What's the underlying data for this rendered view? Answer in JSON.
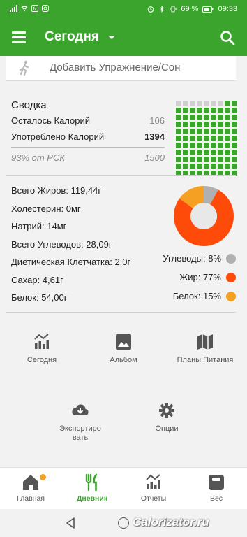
{
  "status_bar": {
    "battery": "69 %",
    "time": "09:33"
  },
  "header": {
    "title": "Сегодня"
  },
  "exercise": {
    "label": "Добавить Упражнение/Сон"
  },
  "summary": {
    "title": "Сводка",
    "remaining_label": "Осталось Калорий",
    "remaining_value": "106",
    "consumed_label": "Употреблено Калорий",
    "consumed_value": "1394",
    "rdi_label": "93% от РСК",
    "rdi_value": "1500",
    "grid_fraction": 0.93
  },
  "nutrients": [
    "Всего Жиров: 119,44г",
    "Холестерин: 0мг",
    "Натрий: 14мг",
    "Всего Углеводов: 28,09г",
    "Диетическая Клетчатка: 2,0г",
    "Сахар: 4,61г",
    "Белок: 54,00г"
  ],
  "macro_legend": [
    {
      "label": "Углеводы: 8%",
      "color": "#b0b0b0",
      "value": 8
    },
    {
      "label": "Жир: 77%",
      "color": "#ff4b0a",
      "value": 77
    },
    {
      "label": "Белок: 15%",
      "color": "#f5a023",
      "value": 15
    }
  ],
  "shortcuts": {
    "today": "Сегодня",
    "album": "Альбом",
    "plans": "Планы Питания",
    "export": "Экспортиро вать",
    "options": "Опции"
  },
  "bottom_nav": {
    "home": "Главная",
    "diary": "Дневник",
    "reports": "Отчеты",
    "weight": "Вес"
  },
  "watermark": "Calorizator.ru",
  "colors": {
    "brand": "#3aa42c",
    "fat": "#ff4b0a",
    "protein": "#f5a023",
    "carbs": "#b0b0b0"
  }
}
